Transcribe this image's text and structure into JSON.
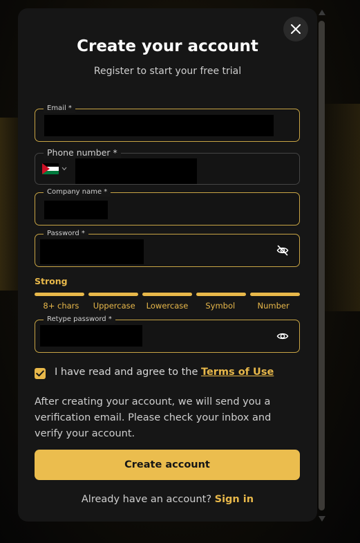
{
  "dialog": {
    "title": "Create your account",
    "subtitle": "Register to start your free trial"
  },
  "fields": {
    "email": {
      "label": "Email *",
      "value": ""
    },
    "phone": {
      "label": "Phone number *",
      "country_flag": "jordan-flag",
      "value": ""
    },
    "company": {
      "label": "Company name *",
      "value": ""
    },
    "password": {
      "label": "Password *",
      "value": "",
      "toggle_icon": "eye-off-icon"
    },
    "retype_password": {
      "label": "Retype password *",
      "value": "",
      "toggle_icon": "eye-icon"
    }
  },
  "strength": {
    "label": "Strong",
    "segments_filled": 5,
    "segments_total": 5,
    "criteria": [
      "8+ chars",
      "Uppercase",
      "Lowercase",
      "Symbol",
      "Number"
    ]
  },
  "terms": {
    "checked": true,
    "text": "I have read and agree to the ",
    "link": "Terms of Use"
  },
  "info_text": "After creating your account, we will send you a verification email. Please check your inbox and verify your account.",
  "create_button": "Create account",
  "signin": {
    "prompt": "Already have an account? ",
    "link": "Sign in"
  },
  "colors": {
    "accent": "#e8b84a",
    "button": "#ebbd4e",
    "modal_bg": "#161616",
    "field_border": "#c9a545"
  }
}
